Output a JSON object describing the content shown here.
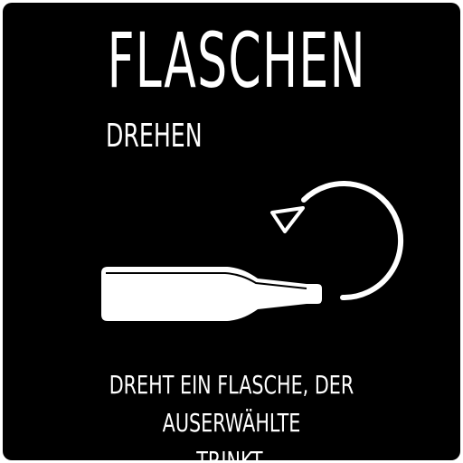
{
  "card": {
    "title": "FLASCHEN",
    "subtitle": "DREHEN",
    "description_line1": "DREHT EIN FLASCHE, DER AUSERWÄHLTE",
    "description_line2": "TRINKT.",
    "icons": [
      "bottle-icon",
      "rotate-arrow-icon"
    ],
    "colors": {
      "background": "#000000",
      "foreground": "#ffffff"
    }
  }
}
